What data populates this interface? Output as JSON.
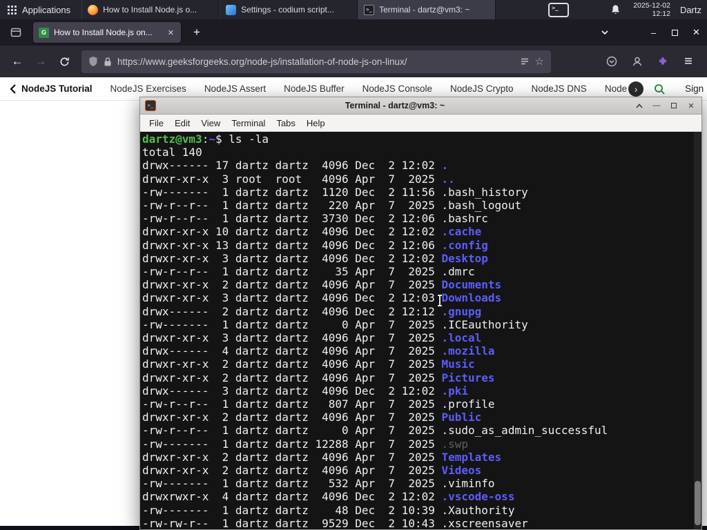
{
  "panel": {
    "applications": "Applications",
    "tasks": [
      {
        "label": "How to Install Node.js o...",
        "icon": "firefox",
        "active": false
      },
      {
        "label": "Settings - codium script...",
        "icon": "settings",
        "active": false
      },
      {
        "label": "Terminal - dartz@vm3: ~",
        "icon": "terminal",
        "active": true
      }
    ],
    "clock": {
      "date": "2025-12-02",
      "time": "12:12"
    },
    "user": "Dartz"
  },
  "browser": {
    "tab_title": "How to Install Node.js on...",
    "favicon_letter": "G",
    "url": "https://www.geeksforgeeks.org/node-js/installation-of-node-js-on-linux/",
    "controls": {
      "new_tab": "+",
      "close_tab": "✕",
      "minimize": "–",
      "close": "✕",
      "menu": "≡",
      "star": "☆"
    }
  },
  "site_nav": {
    "back_label": "NodeJS Tutorial",
    "items": [
      "NodeJS Exercises",
      "NodeJS Assert",
      "NodeJS Buffer",
      "NodeJS Console",
      "NodeJS Crypto",
      "NodeJS DNS",
      "Node"
    ],
    "next_chevron": "›",
    "sign_in": "Sign In"
  },
  "terminal": {
    "title": "Terminal - dartz@vm3: ~",
    "menu": [
      "File",
      "Edit",
      "View",
      "Terminal",
      "Tabs",
      "Help"
    ],
    "icon_glyph": ">_",
    "buttons": {
      "shade": "^",
      "minimize": "—",
      "close": "✕"
    },
    "prompt": {
      "user_host": "dartz@vm3",
      "colon": ":",
      "path": "~",
      "symbol": "$ ",
      "command": "ls -la"
    },
    "total": "total 140",
    "listing": [
      {
        "p": "drwx------",
        "n": "17",
        "o": "dartz",
        "g": "dartz",
        "s": "4096",
        "m": "Dec",
        "d": "2",
        "t": "12:02",
        "f": ".",
        "c": "dir"
      },
      {
        "p": "drwxr-xr-x",
        "n": "3",
        "o": "root",
        "g": "root",
        "s": "4096",
        "m": "Apr",
        "d": "7",
        "t": "2025",
        "f": "..",
        "c": "dir"
      },
      {
        "p": "-rw-------",
        "n": "1",
        "o": "dartz",
        "g": "dartz",
        "s": "1120",
        "m": "Dec",
        "d": "2",
        "t": "11:56",
        "f": ".bash_history",
        "c": "file"
      },
      {
        "p": "-rw-r--r--",
        "n": "1",
        "o": "dartz",
        "g": "dartz",
        "s": "220",
        "m": "Apr",
        "d": "7",
        "t": "2025",
        "f": ".bash_logout",
        "c": "file"
      },
      {
        "p": "-rw-r--r--",
        "n": "1",
        "o": "dartz",
        "g": "dartz",
        "s": "3730",
        "m": "Dec",
        "d": "2",
        "t": "12:06",
        "f": ".bashrc",
        "c": "file"
      },
      {
        "p": "drwxr-xr-x",
        "n": "10",
        "o": "dartz",
        "g": "dartz",
        "s": "4096",
        "m": "Dec",
        "d": "2",
        "t": "12:02",
        "f": ".cache",
        "c": "dir"
      },
      {
        "p": "drwxr-xr-x",
        "n": "13",
        "o": "dartz",
        "g": "dartz",
        "s": "4096",
        "m": "Dec",
        "d": "2",
        "t": "12:06",
        "f": ".config",
        "c": "dir"
      },
      {
        "p": "drwxr-xr-x",
        "n": "3",
        "o": "dartz",
        "g": "dartz",
        "s": "4096",
        "m": "Dec",
        "d": "2",
        "t": "12:02",
        "f": "Desktop",
        "c": "dir"
      },
      {
        "p": "-rw-r--r--",
        "n": "1",
        "o": "dartz",
        "g": "dartz",
        "s": "35",
        "m": "Apr",
        "d": "7",
        "t": "2025",
        "f": ".dmrc",
        "c": "file"
      },
      {
        "p": "drwxr-xr-x",
        "n": "2",
        "o": "dartz",
        "g": "dartz",
        "s": "4096",
        "m": "Apr",
        "d": "7",
        "t": "2025",
        "f": "Documents",
        "c": "dir"
      },
      {
        "p": "drwxr-xr-x",
        "n": "3",
        "o": "dartz",
        "g": "dartz",
        "s": "4096",
        "m": "Dec",
        "d": "2",
        "t": "12:03",
        "f": "Downloads",
        "c": "dir"
      },
      {
        "p": "drwx------",
        "n": "2",
        "o": "dartz",
        "g": "dartz",
        "s": "4096",
        "m": "Dec",
        "d": "2",
        "t": "12:12",
        "f": ".gnupg",
        "c": "dir"
      },
      {
        "p": "-rw-------",
        "n": "1",
        "o": "dartz",
        "g": "dartz",
        "s": "0",
        "m": "Apr",
        "d": "7",
        "t": "2025",
        "f": ".ICEauthority",
        "c": "file"
      },
      {
        "p": "drwxr-xr-x",
        "n": "3",
        "o": "dartz",
        "g": "dartz",
        "s": "4096",
        "m": "Apr",
        "d": "7",
        "t": "2025",
        "f": ".local",
        "c": "dir"
      },
      {
        "p": "drwx------",
        "n": "4",
        "o": "dartz",
        "g": "dartz",
        "s": "4096",
        "m": "Apr",
        "d": "7",
        "t": "2025",
        "f": ".mozilla",
        "c": "dir"
      },
      {
        "p": "drwxr-xr-x",
        "n": "2",
        "o": "dartz",
        "g": "dartz",
        "s": "4096",
        "m": "Apr",
        "d": "7",
        "t": "2025",
        "f": "Music",
        "c": "dir"
      },
      {
        "p": "drwxr-xr-x",
        "n": "2",
        "o": "dartz",
        "g": "dartz",
        "s": "4096",
        "m": "Apr",
        "d": "7",
        "t": "2025",
        "f": "Pictures",
        "c": "dir"
      },
      {
        "p": "drwx------",
        "n": "3",
        "o": "dartz",
        "g": "dartz",
        "s": "4096",
        "m": "Dec",
        "d": "2",
        "t": "12:02",
        "f": ".pki",
        "c": "dir"
      },
      {
        "p": "-rw-r--r--",
        "n": "1",
        "o": "dartz",
        "g": "dartz",
        "s": "807",
        "m": "Apr",
        "d": "7",
        "t": "2025",
        "f": ".profile",
        "c": "file"
      },
      {
        "p": "drwxr-xr-x",
        "n": "2",
        "o": "dartz",
        "g": "dartz",
        "s": "4096",
        "m": "Apr",
        "d": "7",
        "t": "2025",
        "f": "Public",
        "c": "dir"
      },
      {
        "p": "-rw-r--r--",
        "n": "1",
        "o": "dartz",
        "g": "dartz",
        "s": "0",
        "m": "Apr",
        "d": "7",
        "t": "2025",
        "f": ".sudo_as_admin_successful",
        "c": "file"
      },
      {
        "p": "-rw-------",
        "n": "1",
        "o": "dartz",
        "g": "dartz",
        "s": "12288",
        "m": "Apr",
        "d": "7",
        "t": "2025",
        "f": ".swp",
        "c": "dim"
      },
      {
        "p": "drwxr-xr-x",
        "n": "2",
        "o": "dartz",
        "g": "dartz",
        "s": "4096",
        "m": "Apr",
        "d": "7",
        "t": "2025",
        "f": "Templates",
        "c": "dir"
      },
      {
        "p": "drwxr-xr-x",
        "n": "2",
        "o": "dartz",
        "g": "dartz",
        "s": "4096",
        "m": "Apr",
        "d": "7",
        "t": "2025",
        "f": "Videos",
        "c": "dir"
      },
      {
        "p": "-rw-------",
        "n": "1",
        "o": "dartz",
        "g": "dartz",
        "s": "532",
        "m": "Apr",
        "d": "7",
        "t": "2025",
        "f": ".viminfo",
        "c": "file"
      },
      {
        "p": "drwxrwxr-x",
        "n": "4",
        "o": "dartz",
        "g": "dartz",
        "s": "4096",
        "m": "Dec",
        "d": "2",
        "t": "12:02",
        "f": ".vscode-oss",
        "c": "dir"
      },
      {
        "p": "-rw-------",
        "n": "1",
        "o": "dartz",
        "g": "dartz",
        "s": "48",
        "m": "Dec",
        "d": "2",
        "t": "10:39",
        "f": ".Xauthority",
        "c": "file"
      },
      {
        "p": "-rw-rw-r--",
        "n": "1",
        "o": "dartz",
        "g": "dartz",
        "s": "9529",
        "m": "Dec",
        "d": "2",
        "t": "10:43",
        "f": ".xscreensaver",
        "c": "file"
      }
    ]
  }
}
